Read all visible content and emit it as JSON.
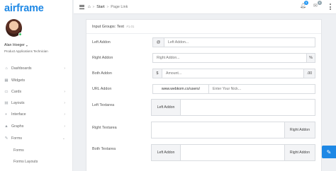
{
  "app": {
    "logo": "airframe"
  },
  "user": {
    "name": "Alan Hoeger",
    "role": "Product Applications Technician"
  },
  "sidebar": {
    "items": [
      {
        "label": "Dashboards",
        "icon": "home-icon",
        "glyph": "⌂"
      },
      {
        "label": "Widgets",
        "icon": "grid-icon",
        "glyph": "▦"
      },
      {
        "label": "Cards",
        "icon": "card-icon",
        "glyph": "▭"
      },
      {
        "label": "Layouts",
        "icon": "layout-icon",
        "glyph": "▤"
      },
      {
        "label": "Interface",
        "icon": "toggle-icon",
        "glyph": "◐"
      },
      {
        "label": "Graphs",
        "icon": "chart-icon",
        "glyph": "▲"
      },
      {
        "label": "Forms",
        "icon": "edit-icon",
        "glyph": "✎"
      }
    ],
    "subitems": [
      {
        "label": "Forms"
      },
      {
        "label": "Forms Layouts"
      }
    ]
  },
  "topbar": {
    "breadcrumb": {
      "start": "Start",
      "current": "Page Link"
    },
    "notifications_count": "5",
    "messages_count": "6"
  },
  "card": {
    "title": "Input Groups: Text",
    "subtitle": "#1.01",
    "rows": {
      "left_addon": {
        "label": "Left Addon",
        "addon": "@",
        "placeholder": "Left Addon..."
      },
      "right_addon": {
        "label": "Right Addon",
        "addon": "%",
        "placeholder": "Right Addon..."
      },
      "both_addon": {
        "label": "Both Addon",
        "left": "$",
        "right": ".00",
        "placeholder": "Amount..."
      },
      "url_addon": {
        "label": "URL Addon",
        "addon": "www.webkom.co/users/",
        "placeholder": "Enter Your Nick..."
      },
      "left_textarea": {
        "label": "Left Textarea",
        "addon": "Left Addon"
      },
      "right_textarea": {
        "label": "Right Textarea",
        "addon": "Right Addon"
      },
      "both_textarea": {
        "label": "Both Textarea",
        "left": "Left Addon",
        "right": "Right Addon"
      }
    }
  },
  "colors": {
    "brand": "#1e88e5",
    "status_online": "#3cc46a"
  }
}
